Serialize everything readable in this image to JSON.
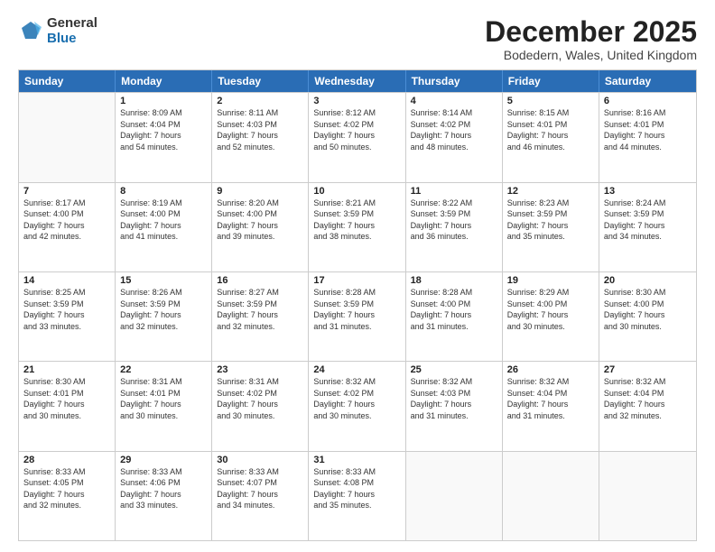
{
  "logo": {
    "general": "General",
    "blue": "Blue"
  },
  "title": "December 2025",
  "location": "Bodedern, Wales, United Kingdom",
  "days_of_week": [
    "Sunday",
    "Monday",
    "Tuesday",
    "Wednesday",
    "Thursday",
    "Friday",
    "Saturday"
  ],
  "weeks": [
    [
      {
        "day": "",
        "info": ""
      },
      {
        "day": "1",
        "info": "Sunrise: 8:09 AM\nSunset: 4:04 PM\nDaylight: 7 hours\nand 54 minutes."
      },
      {
        "day": "2",
        "info": "Sunrise: 8:11 AM\nSunset: 4:03 PM\nDaylight: 7 hours\nand 52 minutes."
      },
      {
        "day": "3",
        "info": "Sunrise: 8:12 AM\nSunset: 4:02 PM\nDaylight: 7 hours\nand 50 minutes."
      },
      {
        "day": "4",
        "info": "Sunrise: 8:14 AM\nSunset: 4:02 PM\nDaylight: 7 hours\nand 48 minutes."
      },
      {
        "day": "5",
        "info": "Sunrise: 8:15 AM\nSunset: 4:01 PM\nDaylight: 7 hours\nand 46 minutes."
      },
      {
        "day": "6",
        "info": "Sunrise: 8:16 AM\nSunset: 4:01 PM\nDaylight: 7 hours\nand 44 minutes."
      }
    ],
    [
      {
        "day": "7",
        "info": "Sunrise: 8:17 AM\nSunset: 4:00 PM\nDaylight: 7 hours\nand 42 minutes."
      },
      {
        "day": "8",
        "info": "Sunrise: 8:19 AM\nSunset: 4:00 PM\nDaylight: 7 hours\nand 41 minutes."
      },
      {
        "day": "9",
        "info": "Sunrise: 8:20 AM\nSunset: 4:00 PM\nDaylight: 7 hours\nand 39 minutes."
      },
      {
        "day": "10",
        "info": "Sunrise: 8:21 AM\nSunset: 3:59 PM\nDaylight: 7 hours\nand 38 minutes."
      },
      {
        "day": "11",
        "info": "Sunrise: 8:22 AM\nSunset: 3:59 PM\nDaylight: 7 hours\nand 36 minutes."
      },
      {
        "day": "12",
        "info": "Sunrise: 8:23 AM\nSunset: 3:59 PM\nDaylight: 7 hours\nand 35 minutes."
      },
      {
        "day": "13",
        "info": "Sunrise: 8:24 AM\nSunset: 3:59 PM\nDaylight: 7 hours\nand 34 minutes."
      }
    ],
    [
      {
        "day": "14",
        "info": "Sunrise: 8:25 AM\nSunset: 3:59 PM\nDaylight: 7 hours\nand 33 minutes."
      },
      {
        "day": "15",
        "info": "Sunrise: 8:26 AM\nSunset: 3:59 PM\nDaylight: 7 hours\nand 32 minutes."
      },
      {
        "day": "16",
        "info": "Sunrise: 8:27 AM\nSunset: 3:59 PM\nDaylight: 7 hours\nand 32 minutes."
      },
      {
        "day": "17",
        "info": "Sunrise: 8:28 AM\nSunset: 3:59 PM\nDaylight: 7 hours\nand 31 minutes."
      },
      {
        "day": "18",
        "info": "Sunrise: 8:28 AM\nSunset: 4:00 PM\nDaylight: 7 hours\nand 31 minutes."
      },
      {
        "day": "19",
        "info": "Sunrise: 8:29 AM\nSunset: 4:00 PM\nDaylight: 7 hours\nand 30 minutes."
      },
      {
        "day": "20",
        "info": "Sunrise: 8:30 AM\nSunset: 4:00 PM\nDaylight: 7 hours\nand 30 minutes."
      }
    ],
    [
      {
        "day": "21",
        "info": "Sunrise: 8:30 AM\nSunset: 4:01 PM\nDaylight: 7 hours\nand 30 minutes."
      },
      {
        "day": "22",
        "info": "Sunrise: 8:31 AM\nSunset: 4:01 PM\nDaylight: 7 hours\nand 30 minutes."
      },
      {
        "day": "23",
        "info": "Sunrise: 8:31 AM\nSunset: 4:02 PM\nDaylight: 7 hours\nand 30 minutes."
      },
      {
        "day": "24",
        "info": "Sunrise: 8:32 AM\nSunset: 4:02 PM\nDaylight: 7 hours\nand 30 minutes."
      },
      {
        "day": "25",
        "info": "Sunrise: 8:32 AM\nSunset: 4:03 PM\nDaylight: 7 hours\nand 31 minutes."
      },
      {
        "day": "26",
        "info": "Sunrise: 8:32 AM\nSunset: 4:04 PM\nDaylight: 7 hours\nand 31 minutes."
      },
      {
        "day": "27",
        "info": "Sunrise: 8:32 AM\nSunset: 4:04 PM\nDaylight: 7 hours\nand 32 minutes."
      }
    ],
    [
      {
        "day": "28",
        "info": "Sunrise: 8:33 AM\nSunset: 4:05 PM\nDaylight: 7 hours\nand 32 minutes."
      },
      {
        "day": "29",
        "info": "Sunrise: 8:33 AM\nSunset: 4:06 PM\nDaylight: 7 hours\nand 33 minutes."
      },
      {
        "day": "30",
        "info": "Sunrise: 8:33 AM\nSunset: 4:07 PM\nDaylight: 7 hours\nand 34 minutes."
      },
      {
        "day": "31",
        "info": "Sunrise: 8:33 AM\nSunset: 4:08 PM\nDaylight: 7 hours\nand 35 minutes."
      },
      {
        "day": "",
        "info": ""
      },
      {
        "day": "",
        "info": ""
      },
      {
        "day": "",
        "info": ""
      }
    ]
  ]
}
